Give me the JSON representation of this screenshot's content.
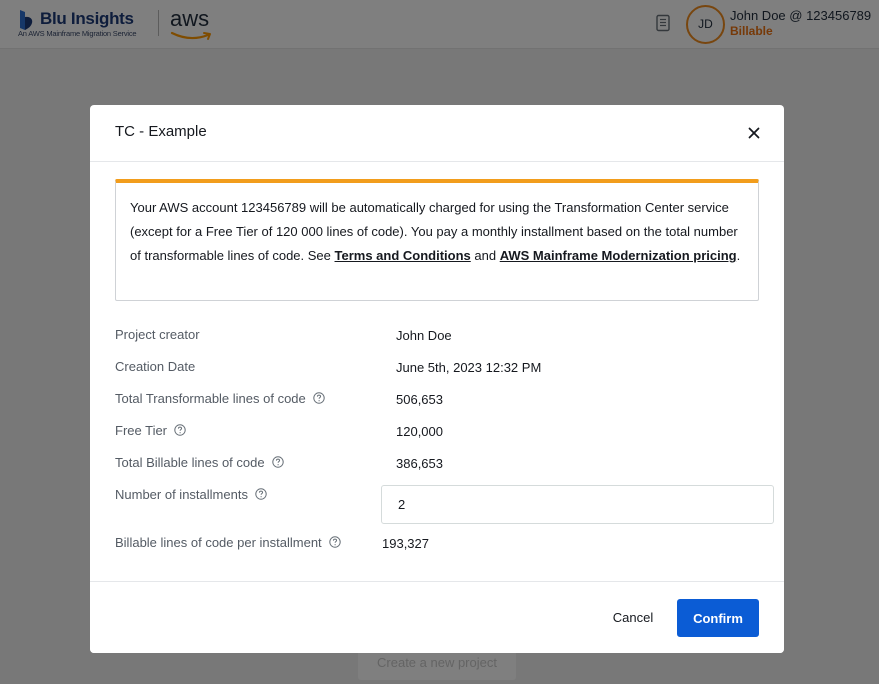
{
  "header": {
    "brand_title": "Blu Insights",
    "brand_subtitle": "An AWS Mainframe Migration Service",
    "aws_word": "aws",
    "user_initials": "JD",
    "user_name": "John Doe @ 123456789",
    "user_plan": "Billable"
  },
  "background": {
    "create_project_label": "Create a new project"
  },
  "modal": {
    "title": "TC - Example",
    "alert": {
      "text_before": "Your AWS account 123456789 will be automatically charged for using the Transformation Center service (except for a Free Tier of 120 000 lines of code). You pay a monthly installment based on the total number of transformable lines of code. See ",
      "link_terms": "Terms and Conditions",
      "text_and": " and ",
      "link_pricing": "AWS Mainframe Modernization pricing",
      "text_end": "."
    },
    "fields": {
      "project_creator": {
        "label": "Project creator",
        "value": "John Doe"
      },
      "creation_date": {
        "label": "Creation Date",
        "value": "June 5th, 2023 12:32 PM"
      },
      "total_transformable": {
        "label": "Total Transformable lines of code",
        "value": "506,653"
      },
      "free_tier": {
        "label": "Free Tier",
        "value": "120,000"
      },
      "total_billable": {
        "label": "Total Billable lines of code",
        "value": "386,653"
      },
      "installments": {
        "label": "Number of installments",
        "value": "2"
      },
      "per_installment": {
        "label": "Billable lines of code per installment",
        "value": "193,327"
      }
    },
    "footer": {
      "cancel_label": "Cancel",
      "confirm_label": "Confirm"
    }
  },
  "colors": {
    "primary": "#0b5cd5",
    "warning": "#f29d1c",
    "billable": "#ec7211",
    "brand": "#1d3a78"
  }
}
